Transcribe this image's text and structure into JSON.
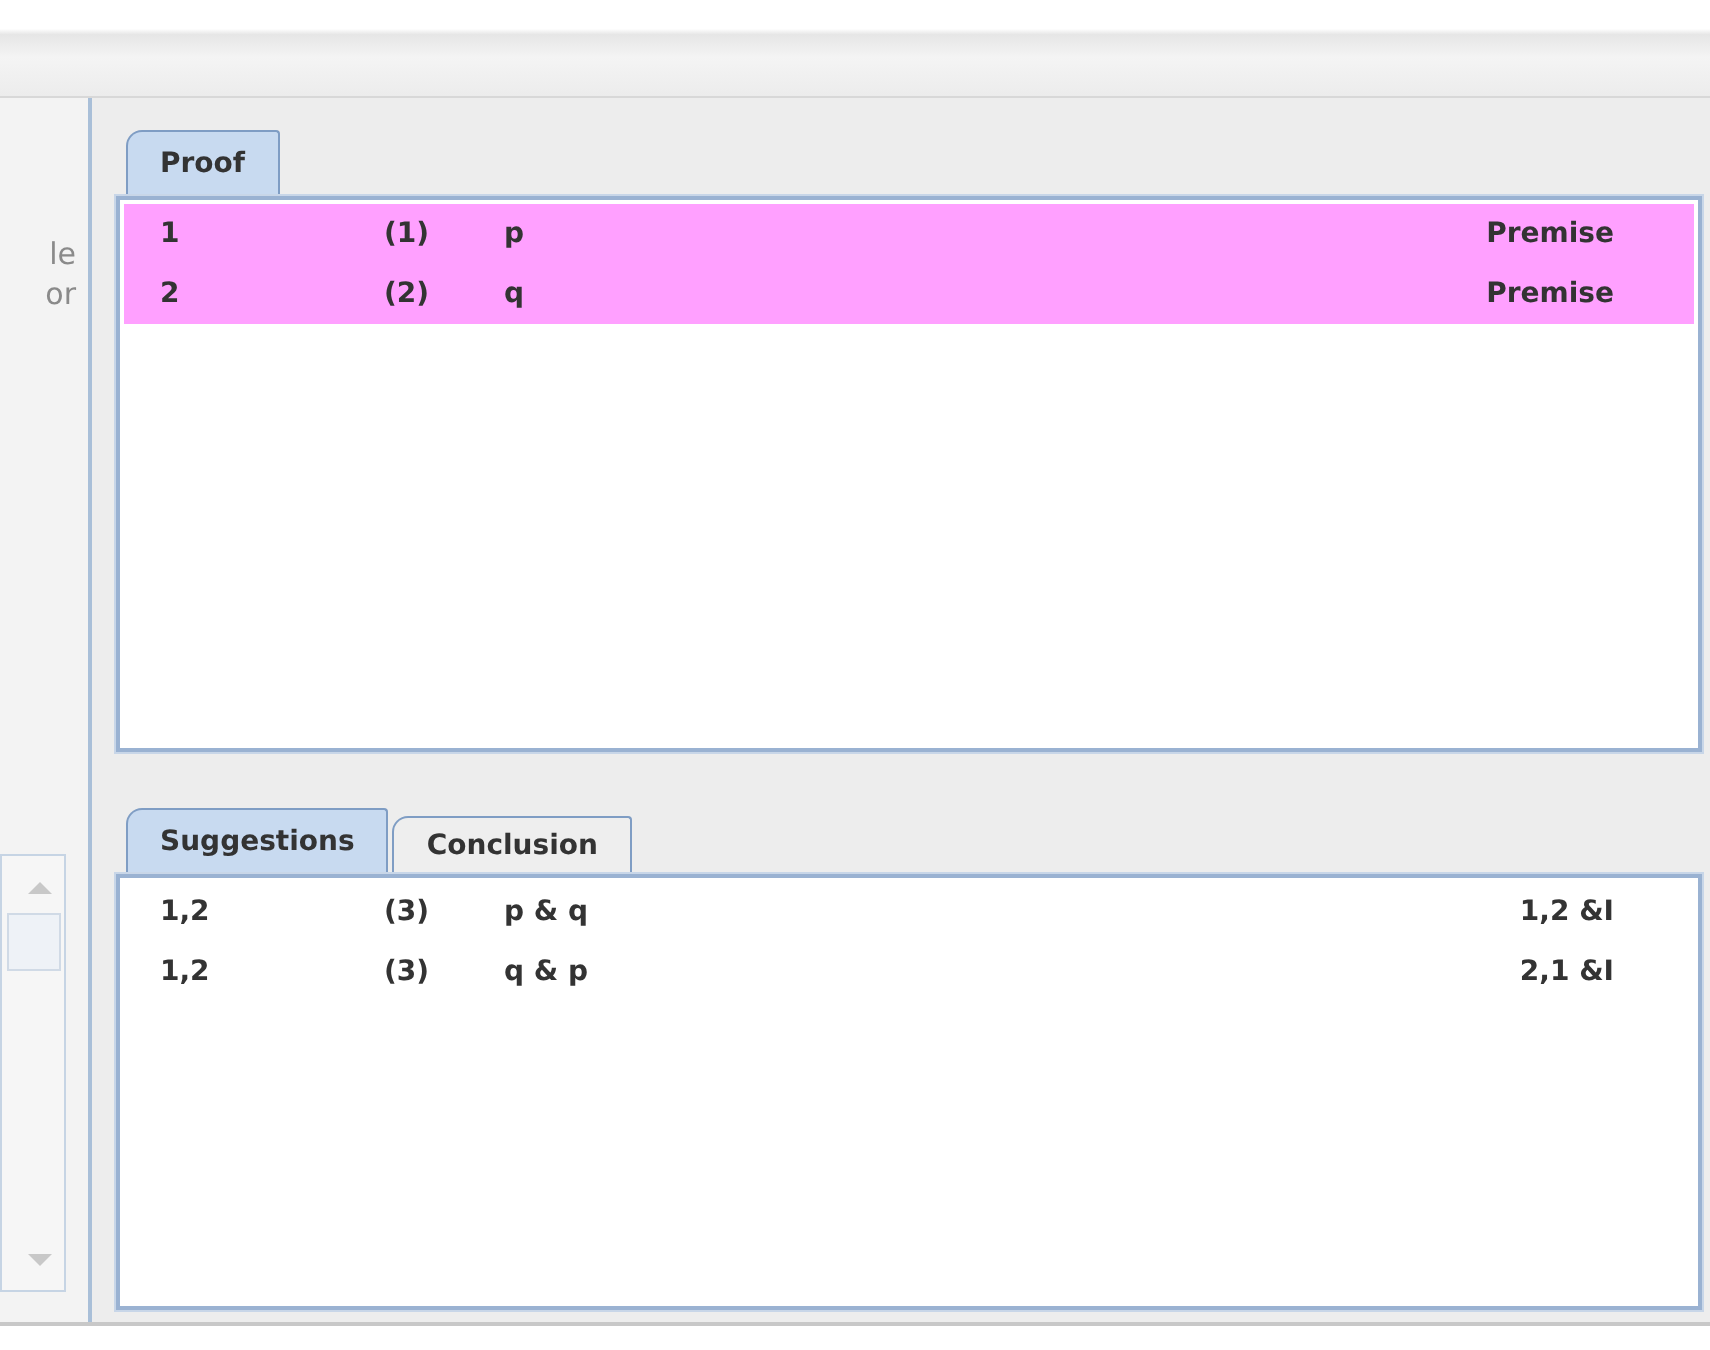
{
  "side_pane": {
    "texts": [
      "le",
      "or"
    ]
  },
  "proof_panel": {
    "tabs": [
      {
        "label": "Proof",
        "selected": true
      }
    ],
    "rows": [
      {
        "lines": "1",
        "number": "(1)",
        "formula": "p",
        "rule": "Premise",
        "highlighted": true
      },
      {
        "lines": "2",
        "number": "(2)",
        "formula": "q",
        "rule": "Premise",
        "highlighted": true
      }
    ]
  },
  "lower_panel": {
    "tabs": [
      {
        "label": "Suggestions",
        "selected": true
      },
      {
        "label": "Conclusion",
        "selected": false
      }
    ],
    "rows": [
      {
        "lines": "1,2",
        "number": "(3)",
        "formula": "p & q",
        "rule": "1,2 &I",
        "highlighted": false
      },
      {
        "lines": "1,2",
        "number": "(3)",
        "formula": "q & p",
        "rule": "2,1 &I",
        "highlighted": false
      }
    ]
  }
}
